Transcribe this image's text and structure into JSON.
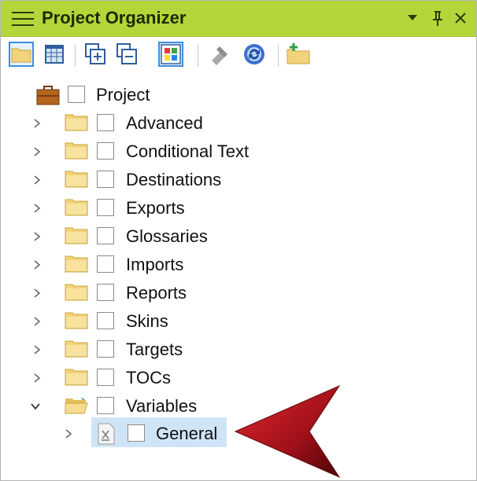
{
  "panel": {
    "title": "Project Organizer",
    "dropdown_glyph": "▾",
    "pin_glyph": "📌",
    "close_glyph": "✕"
  },
  "toolbar": {
    "buttons": [
      {
        "icon": "folder-icon",
        "active": true
      },
      {
        "icon": "grid-view-icon",
        "active": false
      },
      {
        "icon": "expand-all-icon",
        "active": false
      },
      {
        "icon": "collapse-all-icon",
        "active": false
      },
      {
        "icon": "color-tiles-icon",
        "active": true
      },
      {
        "icon": "bind-icon",
        "active": false
      },
      {
        "icon": "refresh-icon",
        "active": false
      },
      {
        "icon": "new-folder-icon",
        "active": false
      }
    ]
  },
  "tree": {
    "root": {
      "label": "Project",
      "icon": "briefcase-icon"
    },
    "items": [
      {
        "label": "Advanced",
        "expanded": false
      },
      {
        "label": "Conditional Text",
        "expanded": false
      },
      {
        "label": "Destinations",
        "expanded": false
      },
      {
        "label": "Exports",
        "expanded": false
      },
      {
        "label": "Glossaries",
        "expanded": false
      },
      {
        "label": "Imports",
        "expanded": false
      },
      {
        "label": "Reports",
        "expanded": false
      },
      {
        "label": "Skins",
        "expanded": false
      },
      {
        "label": "Targets",
        "expanded": false
      },
      {
        "label": "TOCs",
        "expanded": false
      },
      {
        "label": "Variables",
        "expanded": true
      }
    ],
    "child": {
      "label": "General",
      "icon": "variable-file-icon",
      "selected": true
    }
  },
  "colors": {
    "titlebar": "#b5d63a",
    "selection": "#cfe4f7",
    "folder": "#f2d27a",
    "arrow": "#b0141c"
  }
}
